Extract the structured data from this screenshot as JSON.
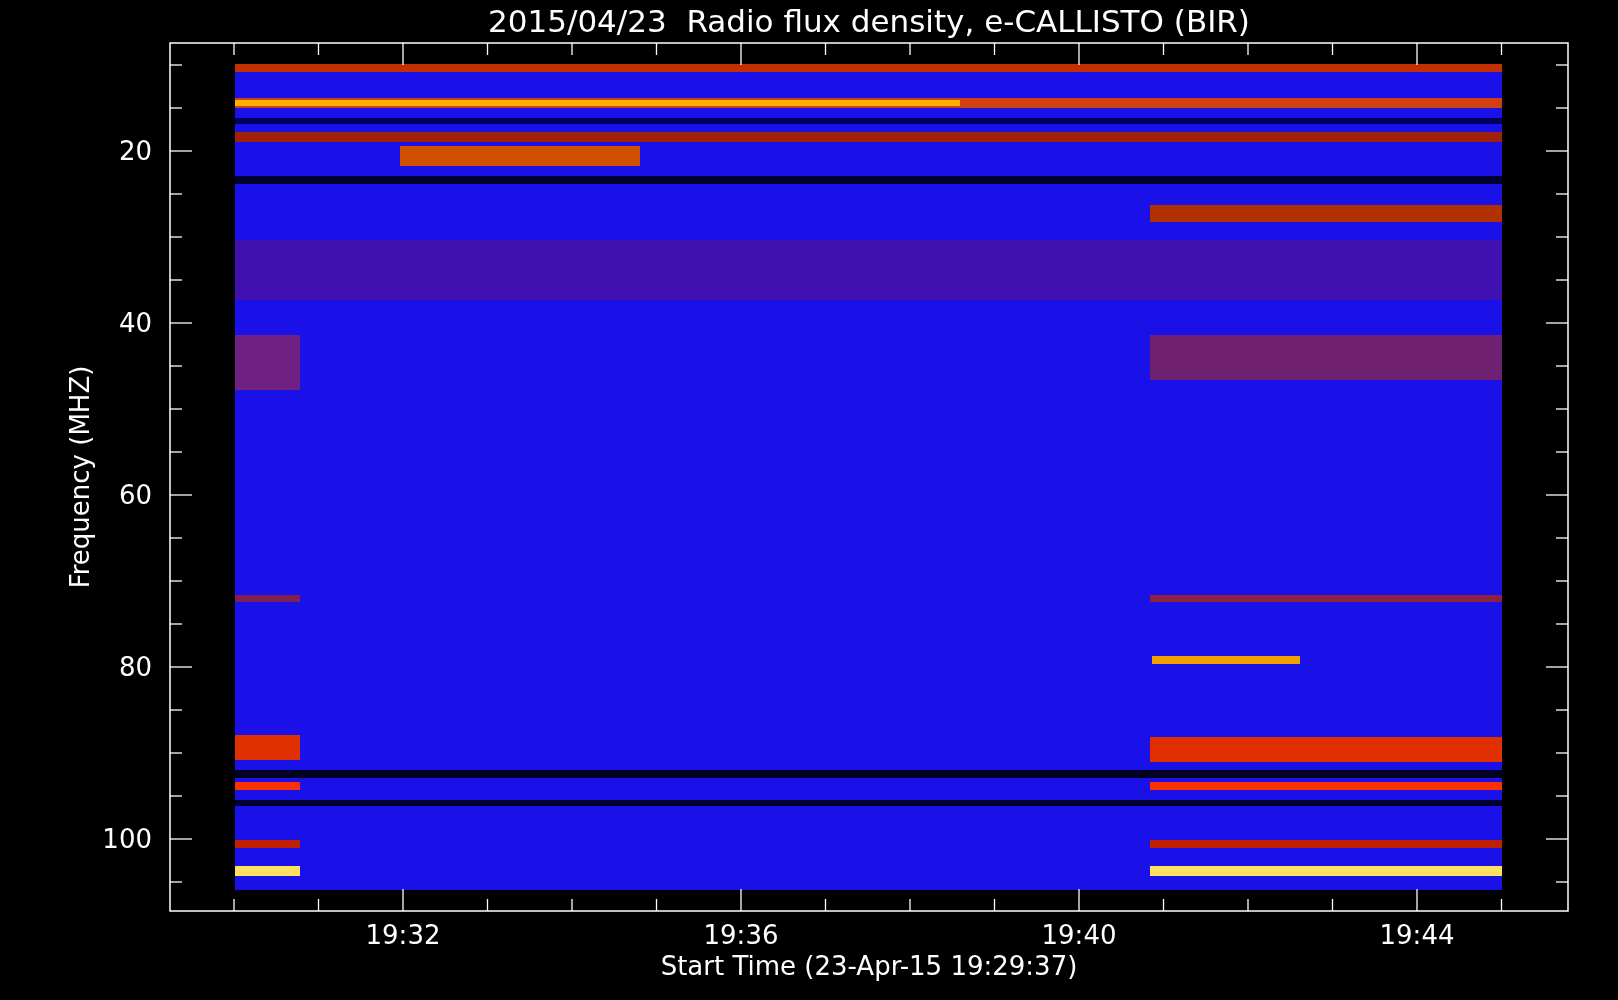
{
  "title": "2015/04/23  Radio flux density, e-CALLISTO (BIR)",
  "y_axis": {
    "label": "Frequency (MHZ)",
    "ticks": [
      "20",
      "40",
      "60",
      "80",
      "100"
    ]
  },
  "x_axis": {
    "label": "Start Time (23-Apr-15 19:29:37)",
    "ticks": [
      "19:32",
      "19:36",
      "19:40",
      "19:44"
    ]
  }
}
